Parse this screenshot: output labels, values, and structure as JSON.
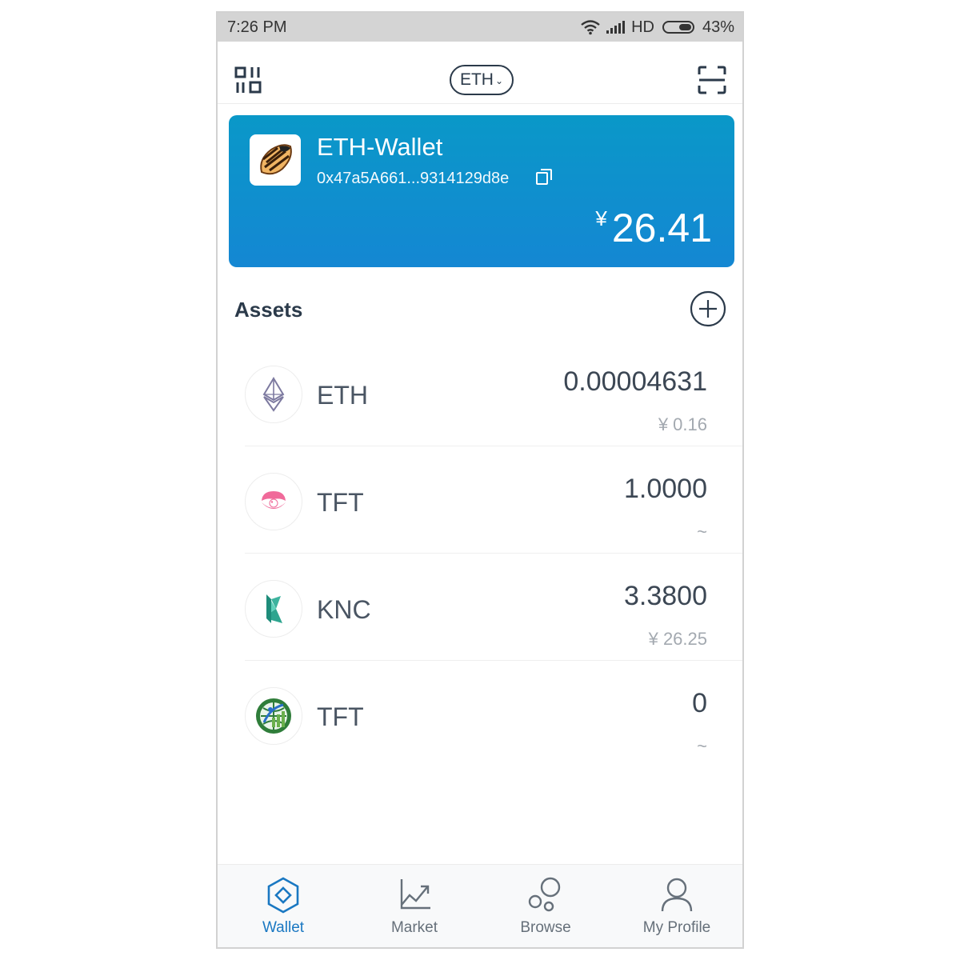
{
  "status_bar": {
    "time": "7:26 PM",
    "network": "HD",
    "battery": "43%",
    "battery_level": 0.43,
    "icons": [
      "wifi-icon",
      "signal-icon",
      "battery-icon"
    ]
  },
  "top_nav": {
    "chain_selector": "ETH",
    "left_icon": "qr-code-icon",
    "right_icon": "scan-icon"
  },
  "wallet_card": {
    "name": "ETH-Wallet",
    "address": "0x47a5A661...9314129d8e",
    "currency_symbol": "¥",
    "balance": "26.41",
    "colors": {
      "gradient_top": "#0a98c8",
      "gradient_bottom": "#1487d3"
    }
  },
  "assets": {
    "title": "Assets",
    "add_icon": "plus-circle-icon",
    "items": [
      {
        "symbol": "ETH",
        "amount": "0.00004631",
        "value": "¥ 0.16",
        "icon": "ethereum-icon"
      },
      {
        "symbol": "TFT",
        "amount": "1.0000",
        "value": "~",
        "icon": "shell-pearl-icon"
      },
      {
        "symbol": "KNC",
        "amount": "3.3800",
        "value": "¥ 26.25",
        "icon": "kyber-icon"
      },
      {
        "symbol": "TFT",
        "amount": "0",
        "value": "~",
        "icon": "globe-growth-icon"
      }
    ]
  },
  "bottom_nav": {
    "active_color": "#1a78c2",
    "items": [
      {
        "label": "Wallet",
        "icon": "wallet-diamond-icon",
        "active": true
      },
      {
        "label": "Market",
        "icon": "market-chart-icon",
        "active": false
      },
      {
        "label": "Browse",
        "icon": "browse-bubbles-icon",
        "active": false
      },
      {
        "label": "My Profile",
        "icon": "profile-person-icon",
        "active": false
      }
    ]
  }
}
